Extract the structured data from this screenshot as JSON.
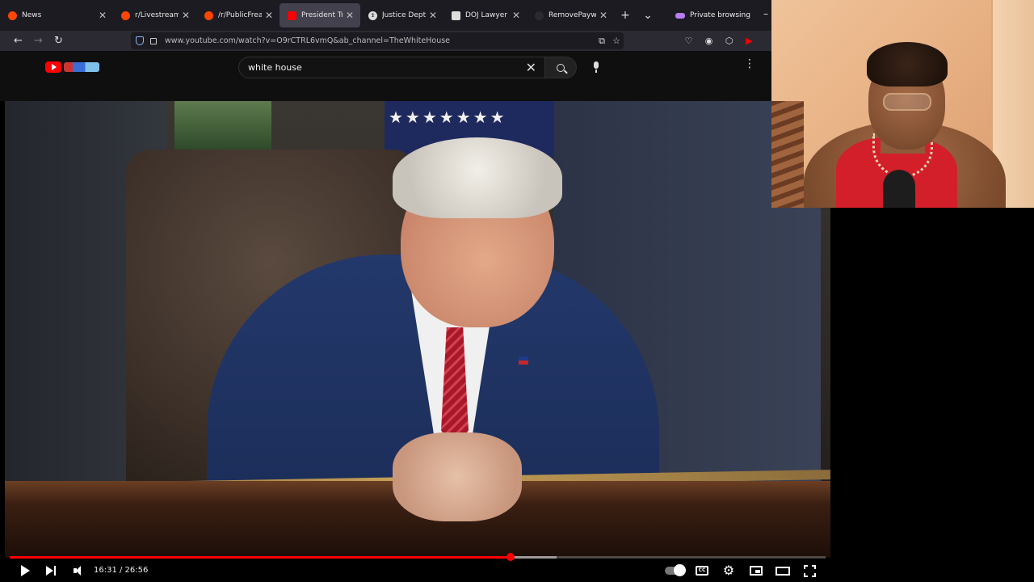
{
  "browser": {
    "tabs": [
      {
        "title": "News",
        "favicon_color": "#ff4500",
        "active": false
      },
      {
        "title": "r/LivestreamFail",
        "favicon_color": "#ff4500",
        "active": false
      },
      {
        "title": "/r/PublicFreakout",
        "favicon_color": "#ff4500",
        "active": false
      },
      {
        "title": "President Trump",
        "favicon_color": "#ff0000",
        "active": true
      },
      {
        "title": "Justice Dept. Acc",
        "favicon_color": "#dddddd",
        "active": false
      },
      {
        "title": "DOJ Lawyer Erez",
        "favicon_color": "#dddddd",
        "active": false
      },
      {
        "title": "RemovePaywall |",
        "favicon_color": "#2b2a33",
        "active": false
      }
    ],
    "private_label": "Private browsing",
    "url": "www.youtube.com/watch?v=O9rCTRL6vmQ&ab_channel=TheWhiteHouse"
  },
  "youtube": {
    "search_value": "white house"
  },
  "player": {
    "current_time": "16:31",
    "duration": "26:56",
    "time_display": "16:31 / 26:56",
    "progress_fraction": 0.614,
    "buffered_fraction": 0.67,
    "accent": "#ff0000"
  },
  "icons": {
    "back": "back-arrow-icon",
    "forward": "forward-arrow-icon",
    "reload": "reload-icon",
    "shield": "shield-icon",
    "lock": "lock-icon",
    "bookmark": "star-icon"
  }
}
